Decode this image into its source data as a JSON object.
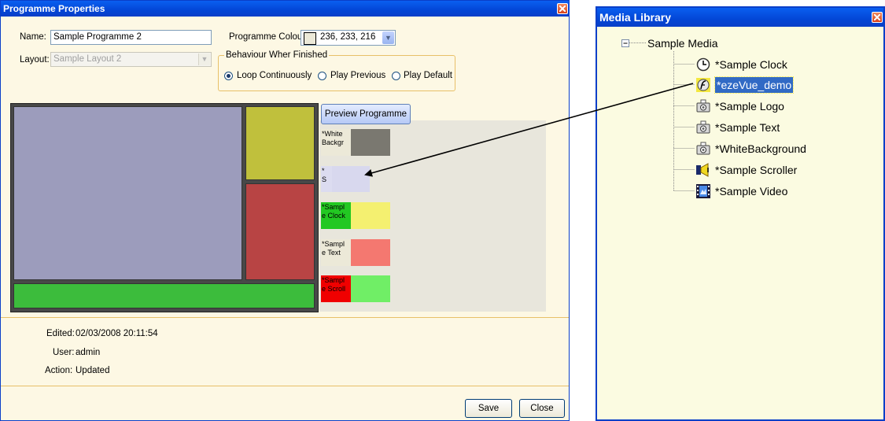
{
  "programme_window": {
    "title": "Programme Properties",
    "name_label": "Name:",
    "name_value": "Sample Programme 2",
    "layout_label": "Layout:",
    "layout_value": "Sample Layout 2",
    "colour_label": "Programme Colour:",
    "colour_value": "236, 233, 216",
    "colour_swatch": "#ece9d8",
    "behaviour_group": "Behaviour Wher Finished",
    "options": [
      "Loop Continuously",
      "Play Previous",
      "Play Default"
    ],
    "selected_option": "Loop Continuously",
    "preview_button": "Preview Programme",
    "tiles": [
      {
        "label": "*White\nBackgr",
        "tag_color": "#ece9d8",
        "fill": "#7a7870"
      },
      {
        "label": "*\nS",
        "tag_color": "#dcdcf0",
        "fill": "#d8d8ee"
      },
      {
        "label": "*Sampl\ne Clock",
        "tag_color": "#22c822",
        "fill": "#f4f070"
      },
      {
        "label": "*Sampl\ne Text",
        "tag_color": "#ece9d8",
        "fill": "#f47870"
      },
      {
        "label": "*Sampl\ne Scroll",
        "tag_color": "#f00000",
        "fill": "#70ee66"
      }
    ],
    "layout_colors": {
      "main": "#9c9cbc",
      "top_right": "#c0c03c",
      "mid_right": "#b84444",
      "bottom": "#3cbc3c"
    },
    "edited_label": "Edited:",
    "edited_value": "02/03/2008 20:11:54",
    "user_label": "User:",
    "user_value": "admin",
    "action_label": "Action:",
    "action_value": "Updated",
    "save_button": "Save",
    "close_button": "Close"
  },
  "media_library": {
    "title": "Media Library",
    "root": "Sample Media",
    "items": [
      {
        "label": "*Sample Clock",
        "icon": "clock-icon",
        "selected": false
      },
      {
        "label": "*ezeVue_demo",
        "icon": "flash-icon",
        "selected": true
      },
      {
        "label": "*Sample Logo",
        "icon": "camera-icon",
        "selected": false
      },
      {
        "label": "*Sample Text",
        "icon": "camera-icon",
        "selected": false
      },
      {
        "label": "*WhiteBackground",
        "icon": "camera-icon",
        "selected": false
      },
      {
        "label": "*Sample Scroller",
        "icon": "megaphone-icon",
        "selected": false
      },
      {
        "label": "*Sample Video",
        "icon": "film-icon",
        "selected": false
      }
    ]
  }
}
